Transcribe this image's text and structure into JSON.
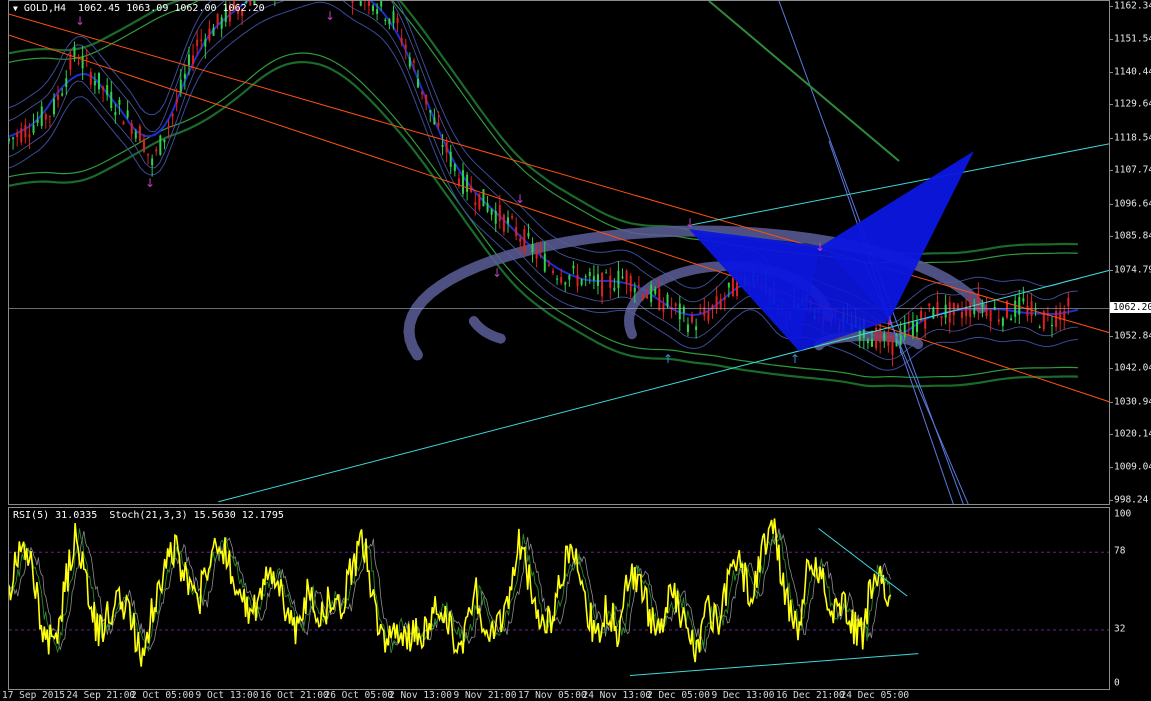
{
  "main_title": {
    "arrow": "▼",
    "text": "GOLD,H4  1062.45 1063.09 1062.00 1062.20"
  },
  "osc_title": {
    "text": "RSI(5) 31.0335  Stoch(21,3,3) 15.5630 12.1795"
  },
  "current_price": "1062.20",
  "colors": {
    "background": "#000000",
    "bull_candle": "#30d050",
    "bear_candle": "#e02020",
    "trend_orange": "#ff5010",
    "trend_cyan": "#40d8d8",
    "pattern_blue": "#0c16e0",
    "rsi": "#ffff10",
    "stoch_main": "#2a8a2a",
    "stoch_signal": "#8c8c8c",
    "bowl": "#5a5e96",
    "fractal_up": "#c040c0",
    "fractal_down": "#3090e0"
  },
  "chart_data": [
    {
      "type": "candlestick",
      "symbol": "GOLD",
      "timeframe": "H4",
      "ohlc_last": {
        "open": 1062.45,
        "high": 1063.09,
        "low": 1062.0,
        "close": 1062.2
      },
      "ylim": [
        998.24,
        1162.34
      ],
      "y_ticks": [
        "1162.34",
        "1151.54",
        "1140.44",
        "1129.64",
        "1118.54",
        "1107.74",
        "1096.64",
        "1085.84",
        "1074.79",
        "1062.20",
        "1052.84",
        "1042.04",
        "1030.94",
        "1020.14",
        "1009.04",
        "998.24"
      ],
      "x_labels": [
        "17 Sep 2015",
        "24 Sep 21:00",
        "2 Oct 05:00",
        "9 Oct 13:00",
        "16 Oct 21:00",
        "26 Oct 05:00",
        "2 Nov 13:00",
        "9 Nov 21:00",
        "17 Nov 05:00",
        "24 Nov 13:00",
        "2 Dec 05:00",
        "9 Dec 13:00",
        "16 Dec 21:00",
        "24 Dec 05:00"
      ],
      "price_path": [
        [
          0,
          1118
        ],
        [
          0.04,
          1128
        ],
        [
          0.06,
          1147
        ],
        [
          0.09,
          1133
        ],
        [
          0.12,
          1120
        ],
        [
          0.13,
          1110
        ],
        [
          0.15,
          1128
        ],
        [
          0.17,
          1150
        ],
        [
          0.2,
          1160
        ],
        [
          0.23,
          1168
        ],
        [
          0.27,
          1173
        ],
        [
          0.29,
          1175
        ],
        [
          0.31,
          1168
        ],
        [
          0.33,
          1165
        ],
        [
          0.35,
          1158
        ],
        [
          0.37,
          1140
        ],
        [
          0.39,
          1120
        ],
        [
          0.41,
          1105
        ],
        [
          0.43,
          1098
        ],
        [
          0.46,
          1088
        ],
        [
          0.48,
          1080
        ],
        [
          0.5,
          1074
        ],
        [
          0.52,
          1072
        ],
        [
          0.54,
          1070
        ],
        [
          0.56,
          1073
        ],
        [
          0.58,
          1067
        ],
        [
          0.6,
          1063
        ],
        [
          0.62,
          1057
        ],
        [
          0.64,
          1062
        ],
        [
          0.66,
          1070
        ],
        [
          0.68,
          1074
        ],
        [
          0.7,
          1060
        ],
        [
          0.72,
          1064
        ],
        [
          0.74,
          1060
        ],
        [
          0.76,
          1058
        ],
        [
          0.78,
          1054
        ],
        [
          0.8,
          1050
        ],
        [
          0.82,
          1056
        ],
        [
          0.84,
          1062
        ],
        [
          0.86,
          1060
        ],
        [
          0.88,
          1064
        ],
        [
          0.9,
          1060
        ],
        [
          0.92,
          1063
        ],
        [
          0.94,
          1058
        ],
        [
          0.96,
          1062
        ]
      ],
      "trendlines": [
        {
          "color": "orange",
          "from": [
            0.0,
            1153
          ],
          "to": [
            1.0,
            1031
          ]
        },
        {
          "color": "orange",
          "from": [
            0.0,
            1160
          ],
          "to": [
            1.0,
            1054
          ]
        },
        {
          "color": "cyan",
          "from": [
            0.19,
            998
          ],
          "to": [
            1.0,
            1075
          ]
        },
        {
          "color": "cyan",
          "from": [
            0.62,
            1090
          ],
          "to": [
            1.0,
            1117
          ]
        }
      ]
    },
    {
      "type": "line",
      "indicator": "RSI(5) / Stoch(21,3,3)",
      "ylim": [
        0,
        100
      ],
      "y_ticks": [
        100,
        78,
        32,
        0
      ],
      "levels": [
        78,
        32
      ],
      "series": [
        {
          "name": "RSI(5)",
          "last": 31.0335
        },
        {
          "name": "Stoch(21,3,3)",
          "last": 15.563,
          "signal_last": 12.1795
        }
      ],
      "rsi_path": [
        [
          0.0,
          55
        ],
        [
          0.01,
          80
        ],
        [
          0.02,
          70
        ],
        [
          0.03,
          35
        ],
        [
          0.04,
          20
        ],
        [
          0.05,
          55
        ],
        [
          0.06,
          90
        ],
        [
          0.07,
          60
        ],
        [
          0.08,
          30
        ],
        [
          0.09,
          40
        ],
        [
          0.1,
          55
        ],
        [
          0.11,
          35
        ],
        [
          0.12,
          20
        ],
        [
          0.13,
          45
        ],
        [
          0.14,
          70
        ],
        [
          0.15,
          80
        ],
        [
          0.16,
          60
        ],
        [
          0.17,
          45
        ],
        [
          0.18,
          75
        ],
        [
          0.19,
          85
        ],
        [
          0.2,
          70
        ],
        [
          0.21,
          50
        ],
        [
          0.22,
          40
        ],
        [
          0.23,
          60
        ],
        [
          0.24,
          65
        ],
        [
          0.25,
          45
        ],
        [
          0.26,
          30
        ],
        [
          0.27,
          55
        ],
        [
          0.28,
          40
        ],
        [
          0.29,
          50
        ],
        [
          0.3,
          45
        ],
        [
          0.31,
          70
        ],
        [
          0.32,
          85
        ],
        [
          0.33,
          40
        ],
        [
          0.34,
          20
        ],
        [
          0.35,
          35
        ],
        [
          0.36,
          30
        ],
        [
          0.37,
          28
        ],
        [
          0.38,
          38
        ],
        [
          0.39,
          45
        ],
        [
          0.4,
          30
        ],
        [
          0.41,
          25
        ],
        [
          0.42,
          55
        ],
        [
          0.43,
          35
        ],
        [
          0.44,
          30
        ],
        [
          0.45,
          50
        ],
        [
          0.46,
          85
        ],
        [
          0.47,
          60
        ],
        [
          0.48,
          35
        ],
        [
          0.49,
          40
        ],
        [
          0.5,
          70
        ],
        [
          0.51,
          75
        ],
        [
          0.52,
          45
        ],
        [
          0.53,
          30
        ],
        [
          0.54,
          45
        ],
        [
          0.55,
          30
        ],
        [
          0.56,
          70
        ],
        [
          0.57,
          60
        ],
        [
          0.58,
          35
        ],
        [
          0.59,
          40
        ],
        [
          0.6,
          55
        ],
        [
          0.61,
          35
        ],
        [
          0.62,
          20
        ],
        [
          0.63,
          45
        ],
        [
          0.64,
          35
        ],
        [
          0.65,
          65
        ],
        [
          0.66,
          70
        ],
        [
          0.67,
          50
        ],
        [
          0.68,
          85
        ],
        [
          0.69,
          90
        ],
        [
          0.7,
          55
        ],
        [
          0.71,
          30
        ],
        [
          0.72,
          65
        ],
        [
          0.73,
          70
        ],
        [
          0.74,
          40
        ],
        [
          0.75,
          50
        ],
        [
          0.76,
          35
        ],
        [
          0.77,
          30
        ],
        [
          0.78,
          70
        ],
        [
          0.79,
          55
        ],
        [
          0.8,
          35
        ],
        [
          0.81,
          50
        ],
        [
          0.82,
          30
        ],
        [
          0.83,
          35
        ],
        [
          0.84,
          45
        ],
        [
          0.85,
          40
        ],
        [
          0.86,
          30
        ],
        [
          0.87,
          25
        ],
        [
          0.88,
          45
        ],
        [
          0.89,
          60
        ],
        [
          0.9,
          45
        ],
        [
          0.91,
          35
        ],
        [
          0.92,
          50
        ],
        [
          0.93,
          30
        ],
        [
          0.94,
          25
        ],
        [
          0.95,
          40
        ],
        [
          0.96,
          45
        ],
        [
          0.97,
          35
        ],
        [
          0.98,
          30
        ]
      ],
      "trendlines": [
        {
          "color": "cyan",
          "from": [
            0.56,
            5
          ],
          "to": [
            0.82,
            18
          ]
        },
        {
          "color": "cyan",
          "from": [
            0.73,
            92
          ],
          "to": [
            0.81,
            52
          ]
        }
      ]
    }
  ]
}
